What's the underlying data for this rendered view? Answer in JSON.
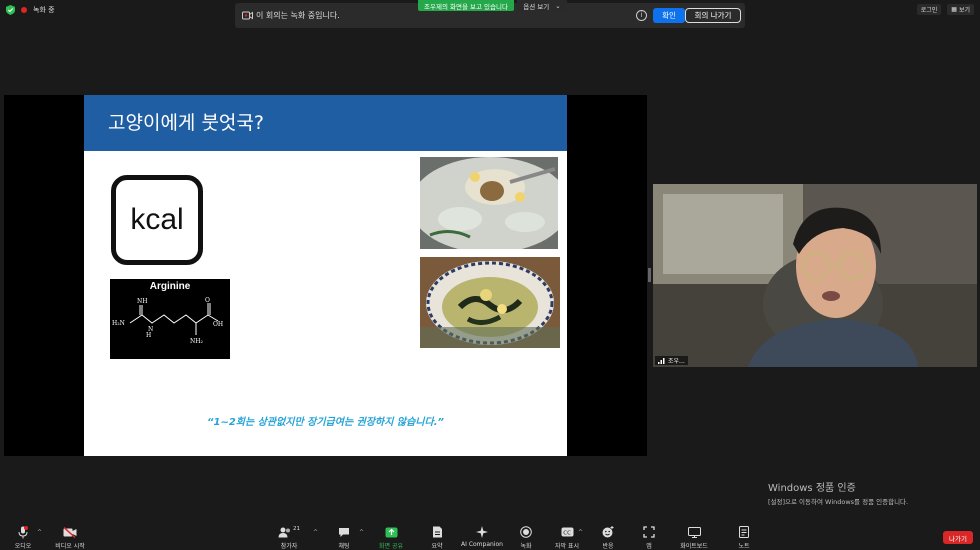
{
  "status": {
    "recording_label": "녹화 중"
  },
  "share_banner": {
    "text": "조우제의 화면을 보고 있습니다",
    "options_label": "옵션 보기"
  },
  "recording_notice": {
    "message": "이 회의는 녹화 중입니다.",
    "confirm_label": "확인",
    "leave_label": "회의 나가기"
  },
  "top_right": {
    "login_label": "로그인",
    "view_label": "보기"
  },
  "slide": {
    "title": "고양이에게 붓엇국?",
    "kcal_label": "kcal",
    "arginine_label": "Arginine",
    "quote": "“1~2회는 상관없지만 장기급여는 권장하지 않습니다.”"
  },
  "participant": {
    "name": "조우..."
  },
  "windows_activation": {
    "title": "Windows 정품 인증",
    "subtitle": "[설정]으로 이동하여 Windows를 정품 인증합니다."
  },
  "toolbar": {
    "audio": "오디오",
    "video": "비디오 시작",
    "participants": "참가자",
    "participants_count": "21",
    "chat": "채팅",
    "share": "화면 공유",
    "summary": "요약",
    "ai": "AI Companion",
    "record": "녹화",
    "captions": "자막 표시",
    "reactions": "반응",
    "apps": "앱",
    "whiteboard": "화이트보드",
    "notes": "노트",
    "leave": "나가기"
  },
  "colors": {
    "slide_header": "#1f5ea3",
    "quote": "#27a3d6",
    "share_banner": "#24a84a",
    "confirm": "#0e72ed",
    "leave": "#d92626"
  }
}
